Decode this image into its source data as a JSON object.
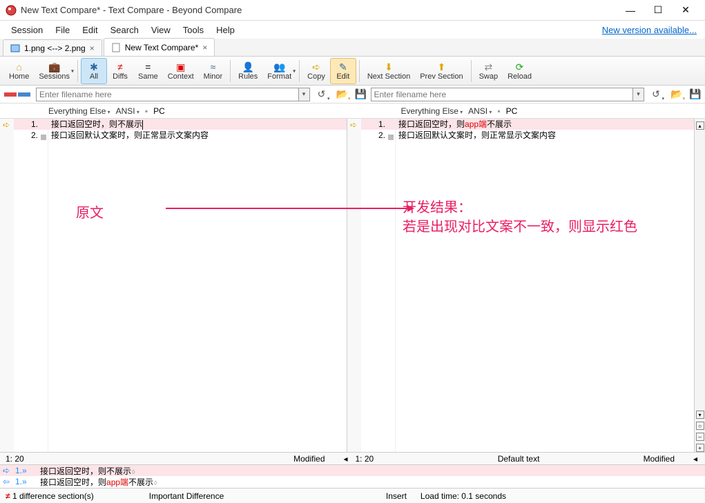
{
  "titlebar": {
    "title": "New Text Compare* - Text Compare - Beyond Compare"
  },
  "menu": {
    "items": [
      "Session",
      "File",
      "Edit",
      "Search",
      "View",
      "Tools",
      "Help"
    ],
    "link": "New version available..."
  },
  "tabs": [
    {
      "label": "1.png <--> 2.png",
      "active": false
    },
    {
      "label": "New Text Compare*",
      "active": true
    }
  ],
  "toolbar": {
    "home": "Home",
    "sessions": "Sessions",
    "all": "All",
    "diffs": "Diffs",
    "same": "Same",
    "context": "Context",
    "minor": "Minor",
    "rules": "Rules",
    "format": "Format",
    "copy": "Copy",
    "edit": "Edit",
    "next": "Next Section",
    "prev": "Prev Section",
    "swap": "Swap",
    "reload": "Reload"
  },
  "filebar": {
    "placeholder": "Enter filename here"
  },
  "subbar": {
    "ee": "Everything Else",
    "enc": "ANSI",
    "plat": "PC"
  },
  "left": {
    "lines": [
      {
        "n": "1.",
        "text": "接口返回空时，则不展示",
        "diff": true
      },
      {
        "n": "2.",
        "text": "接口返回默认文案时，则正常显示文案内容",
        "diff": false
      }
    ]
  },
  "right": {
    "lines": [
      {
        "n": "1.",
        "pre": "接口返回空时，则",
        "red": "app端",
        "post": "不展示",
        "diff": true
      },
      {
        "n": "2.",
        "pre": "接口返回默认文案时，则正常显示文案内容",
        "red": "",
        "post": "",
        "diff": false
      }
    ]
  },
  "annotations": {
    "left": "原文",
    "right": "开发结果：\n若是出现对比文案不一致，则显示红色"
  },
  "ruler": {
    "left_pos": "1: 20",
    "left_status": "Modified",
    "right_pos": "1: 20",
    "right_mid": "Default text",
    "right_status": "Modified"
  },
  "diffview": {
    "l1": {
      "arrow": "➪",
      "num": "1.»",
      "pre": "接口返回空时，则不展示",
      "red": "",
      "post": ""
    },
    "l2": {
      "arrow": "⇦",
      "num": "1.»",
      "pre": "接口返回空时，则",
      "red": "app端",
      "post": "不展示"
    }
  },
  "status": {
    "diff": "1 difference section(s)",
    "type": "Important Difference",
    "mode": "Insert",
    "load": "Load time: 0.1 seconds"
  }
}
